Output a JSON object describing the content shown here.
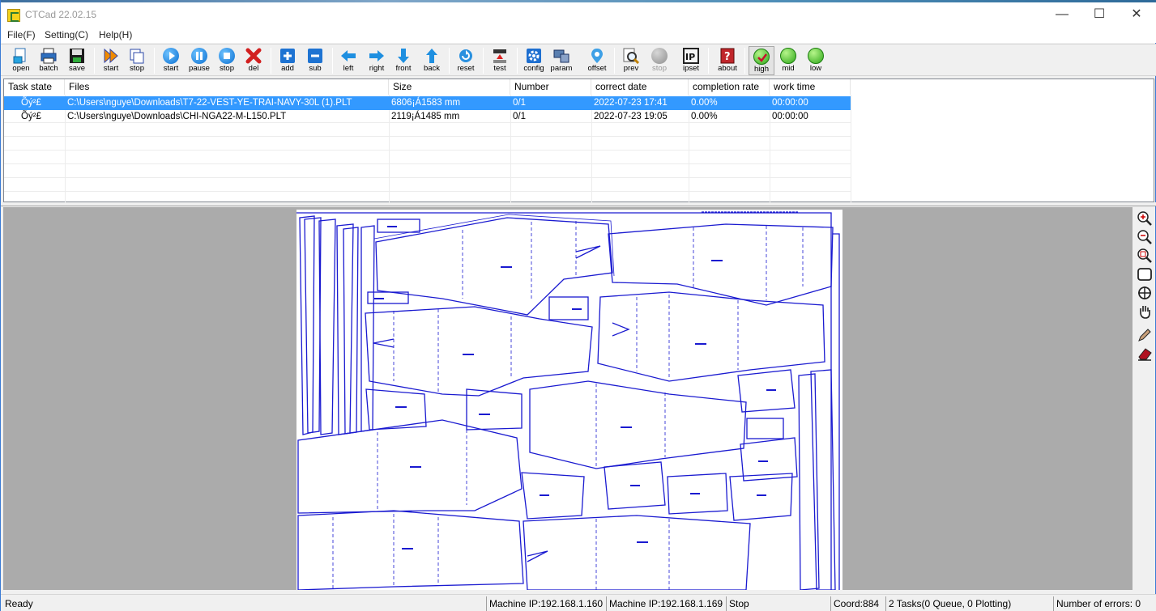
{
  "window": {
    "title": "CTCad 22.02.15"
  },
  "menu": {
    "items": [
      "File(F)",
      "Setting(C)",
      "Help(H)"
    ]
  },
  "toolbar": {
    "open": "open",
    "batch": "batch",
    "save": "save",
    "start1": "start",
    "stop1": "stop",
    "start2": "start",
    "pause": "pause",
    "stop2": "stop",
    "del": "del",
    "add": "add",
    "sub": "sub",
    "left": "left",
    "right": "right",
    "front": "front",
    "back": "back",
    "reset": "reset",
    "test": "test",
    "config": "config",
    "param": "param",
    "offset": "offset",
    "prev": "prev",
    "stop3": "stop",
    "ipset": "ipset",
    "about": "about",
    "high": "high",
    "mid": "mid",
    "low": "low"
  },
  "table": {
    "headers": [
      "Task state",
      "Files",
      "Size",
      "Number",
      "correct date",
      "completion rate",
      "work time"
    ],
    "rows": [
      {
        "state": "Õý²£",
        "file": "C:\\Users\\nguye\\Downloads\\T7-22-VEST-YE-TRAI-NAVY-30L (1).PLT",
        "size": "6806¡Á1583 mm",
        "number": "0/1",
        "date": "2022-07-23 17:41",
        "rate": "0.00%",
        "time": "00:00:00"
      },
      {
        "state": "Õý²£",
        "file": "C:\\Users\\nguye\\Downloads\\CHI-NGA22-M-L150.PLT",
        "size": "2119¡Á1485 mm",
        "number": "0/1",
        "date": "2022-07-23 19:05",
        "rate": "0.00%",
        "time": "00:00:00"
      }
    ]
  },
  "status": {
    "ready": "Ready",
    "ip1": "Machine IP:192.168.1.160",
    "ip2": "Machine IP:192.168.1.169",
    "state": "Stop",
    "coord": "Coord:884",
    "tasks": "2 Tasks(0 Queue, 0 Plotting)",
    "errors": "Number of errors: 0"
  },
  "colors": {
    "accent": "#3399ff",
    "plot": "#1a1ad0",
    "ok": "#2fa81a",
    "danger": "#d21f1f"
  }
}
